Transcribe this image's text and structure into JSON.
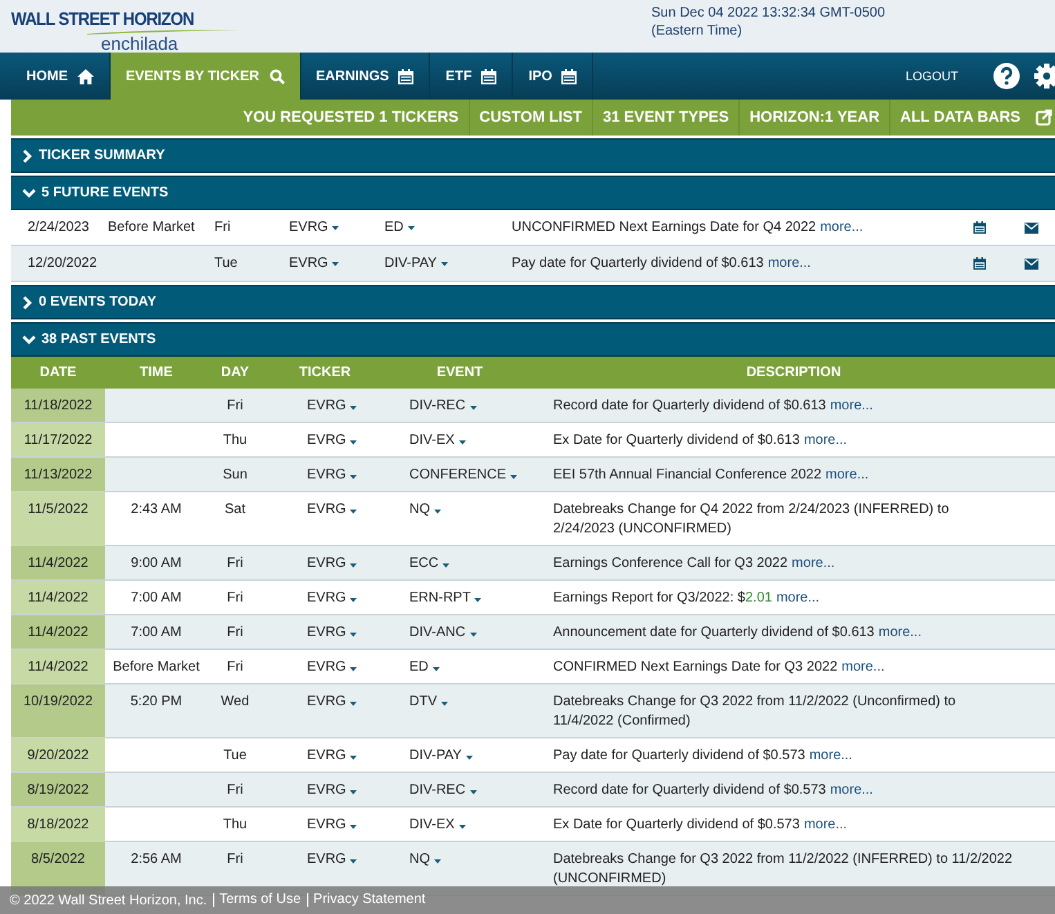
{
  "logo": {
    "name": "WALL STREET HORIZON",
    "product": "enchilada"
  },
  "clock": {
    "datetime": "Sun Dec 04 2022 13:32:34 GMT-0500",
    "zone": "(Eastern Time)"
  },
  "nav": {
    "items": [
      {
        "label": "HOME",
        "selected": false
      },
      {
        "label": "EVENTS BY TICKER",
        "selected": true
      },
      {
        "label": "EARNINGS",
        "selected": false
      },
      {
        "label": "ETF",
        "selected": false
      },
      {
        "label": "IPO",
        "selected": false
      }
    ],
    "logout": "LOGOUT"
  },
  "subbar": [
    "YOU REQUESTED 1 TICKERS",
    "CUSTOM LIST",
    "31 EVENT TYPES",
    "HORIZON:1 YEAR",
    "ALL DATA BARS"
  ],
  "sections": [
    {
      "title": "TICKER SUMMARY",
      "expanded": false
    },
    {
      "kind": "future",
      "title": "5 FUTURE EVENTS",
      "expanded": true,
      "rows": [
        {
          "date": "2/24/2023",
          "time": "Before Market",
          "day": "Fri",
          "ticker": "EVRG",
          "event": "ED",
          "desc": "UNCONFIRMED Next Earnings Date for Q4 2022",
          "more": "more..."
        },
        {
          "date": "12/20/2022",
          "day": "Tue",
          "ticker": "EVRG",
          "event": "DIV-PAY",
          "desc": "Pay date for Quarterly dividend of $0.613",
          "more": "more..."
        }
      ]
    },
    {
      "title": "0 EVENTS TODAY",
      "expanded": false
    },
    {
      "kind": "past",
      "title": "38 PAST EVENTS",
      "expanded": true,
      "columns": [
        "DATE",
        "TIME",
        "DAY",
        "TICKER",
        "EVENT",
        "DESCRIPTION"
      ],
      "rows": [
        {
          "date": "11/18/2022",
          "day": "Fri",
          "ticker": "EVRG",
          "event": "DIV-REC",
          "desc": "Record date for Quarterly dividend of $0.613",
          "more": "more..."
        },
        {
          "date": "11/17/2022",
          "day": "Thu",
          "ticker": "EVRG",
          "event": "DIV-EX",
          "desc": "Ex Date for Quarterly dividend of $0.613",
          "more": "more..."
        },
        {
          "date": "11/13/2022",
          "day": "Sun",
          "ticker": "EVRG",
          "event": "CONFERENCE",
          "desc": "EEI 57th Annual Financial Conference 2022",
          "more": "more..."
        },
        {
          "date": "11/5/2022",
          "time": "2:43 AM",
          "day": "Sat",
          "ticker": "EVRG",
          "event": "NQ",
          "desc": "Datebreaks Change for Q4 2022 from 2/24/2023 (INFERRED) to 2/24/2023 (UNCONFIRMED)"
        },
        {
          "date": "11/4/2022",
          "time": "9:00 AM",
          "day": "Fri",
          "ticker": "EVRG",
          "event": "ECC",
          "desc": "Earnings Conference Call for Q3 2022",
          "more": "more..."
        },
        {
          "date": "11/4/2022",
          "time": "7:00 AM",
          "day": "Fri",
          "ticker": "EVRG",
          "event": "ERN-RPT",
          "desc": "Earnings Report for Q3/2022: $",
          "value": "2.01",
          "more": "more..."
        },
        {
          "date": "11/4/2022",
          "time": "7:00 AM",
          "day": "Fri",
          "ticker": "EVRG",
          "event": "DIV-ANC",
          "desc": "Announcement date for Quarterly dividend of $0.613",
          "more": "more..."
        },
        {
          "date": "11/4/2022",
          "time": "Before Market",
          "day": "Fri",
          "ticker": "EVRG",
          "event": "ED",
          "desc": "CONFIRMED Next Earnings Date for Q3 2022",
          "more": "more..."
        },
        {
          "date": "10/19/2022",
          "time": "5:20 PM",
          "day": "Wed",
          "ticker": "EVRG",
          "event": "DTV",
          "desc": "Datebreaks Change for Q3 2022 from 11/2/2022 (Unconfirmed) to 11/4/2022 (Confirmed)"
        },
        {
          "date": "9/20/2022",
          "day": "Tue",
          "ticker": "EVRG",
          "event": "DIV-PAY",
          "desc": "Pay date for Quarterly dividend of $0.573",
          "more": "more..."
        },
        {
          "date": "8/19/2022",
          "day": "Fri",
          "ticker": "EVRG",
          "event": "DIV-REC",
          "desc": "Record date for Quarterly dividend of $0.573",
          "more": "more..."
        },
        {
          "date": "8/18/2022",
          "day": "Thu",
          "ticker": "EVRG",
          "event": "DIV-EX",
          "desc": "Ex Date for Quarterly dividend of $0.573",
          "more": "more..."
        },
        {
          "date": "8/5/2022",
          "time": "2:56 AM",
          "day": "Fri",
          "ticker": "EVRG",
          "event": "NQ",
          "desc": "Datebreaks Change for Q3 2022 from 11/2/2022 (INFERRED) to 11/2/2022 (UNCONFIRMED)"
        }
      ]
    }
  ],
  "footer": {
    "copyright": "© 2022 Wall Street Horizon, Inc.",
    "links": [
      "Terms of Use",
      "Privacy Statement"
    ]
  }
}
